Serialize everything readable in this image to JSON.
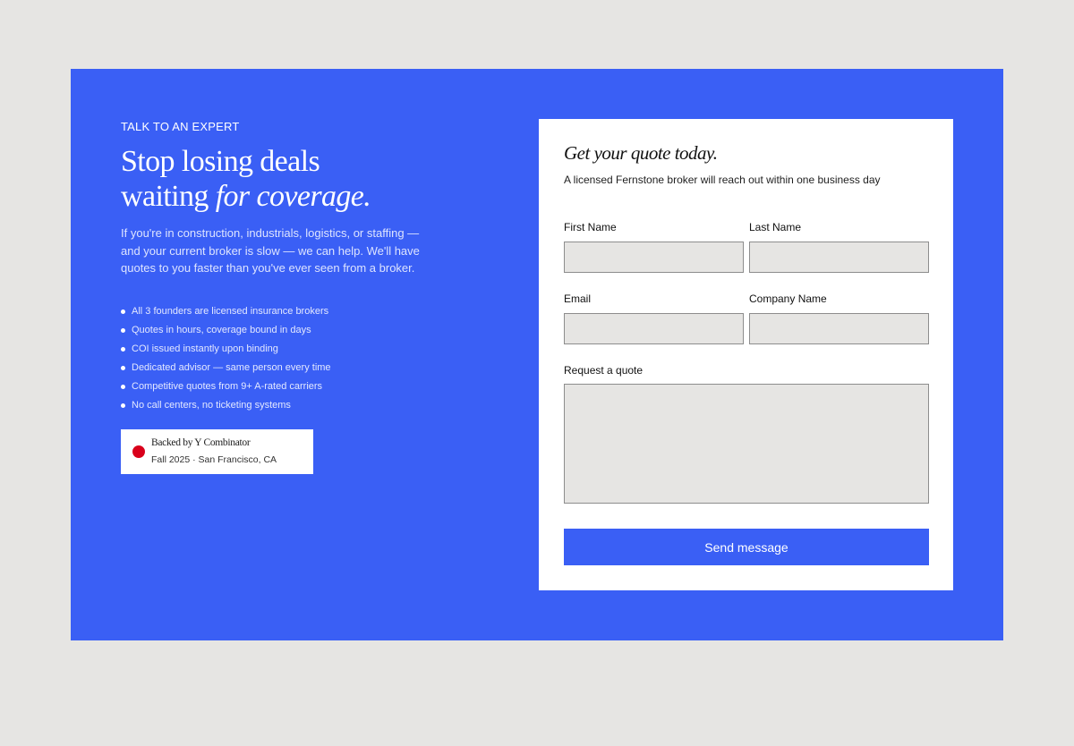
{
  "hero": {
    "eyebrow": "TALK TO AN EXPERT",
    "headline_line1": "Stop losing deals",
    "headline_line2_plain": "waiting ",
    "headline_line2_italic": "for coverage.",
    "intro": "If you're in construction, industrials, logistics, or staffing — and your current broker is slow — we can help. We'll have quotes to you faster than you've ever seen from a broker.",
    "bullets": [
      "All 3 founders are licensed insurance brokers",
      "Quotes in hours, coverage bound in days",
      "COI issued instantly upon binding",
      "Dedicated advisor — same person every time",
      "Competitive quotes from 9+ A-rated carriers",
      "No call centers, no ticketing systems"
    ],
    "badge": {
      "title": "Backed by Y Combinator",
      "subtitle": "Fall 2025 · San Francisco, CA"
    }
  },
  "form": {
    "title": "Get your quote today.",
    "subtitle": "A licensed Fernstone broker will reach out within one business day",
    "first_name_label": "First Name",
    "last_name_label": "Last Name",
    "email_label": "Email",
    "company_label": "Company Name",
    "request_label": "Request a quote",
    "first_name_value": "",
    "last_name_value": "",
    "email_value": "",
    "company_value": "",
    "request_value": "",
    "submit_label": "Send message"
  },
  "colors": {
    "panel_blue": "#3a5ff5",
    "page_background": "#e6e5e3",
    "input_background": "#e6e5e3",
    "badge_dot": "#d9001b"
  }
}
